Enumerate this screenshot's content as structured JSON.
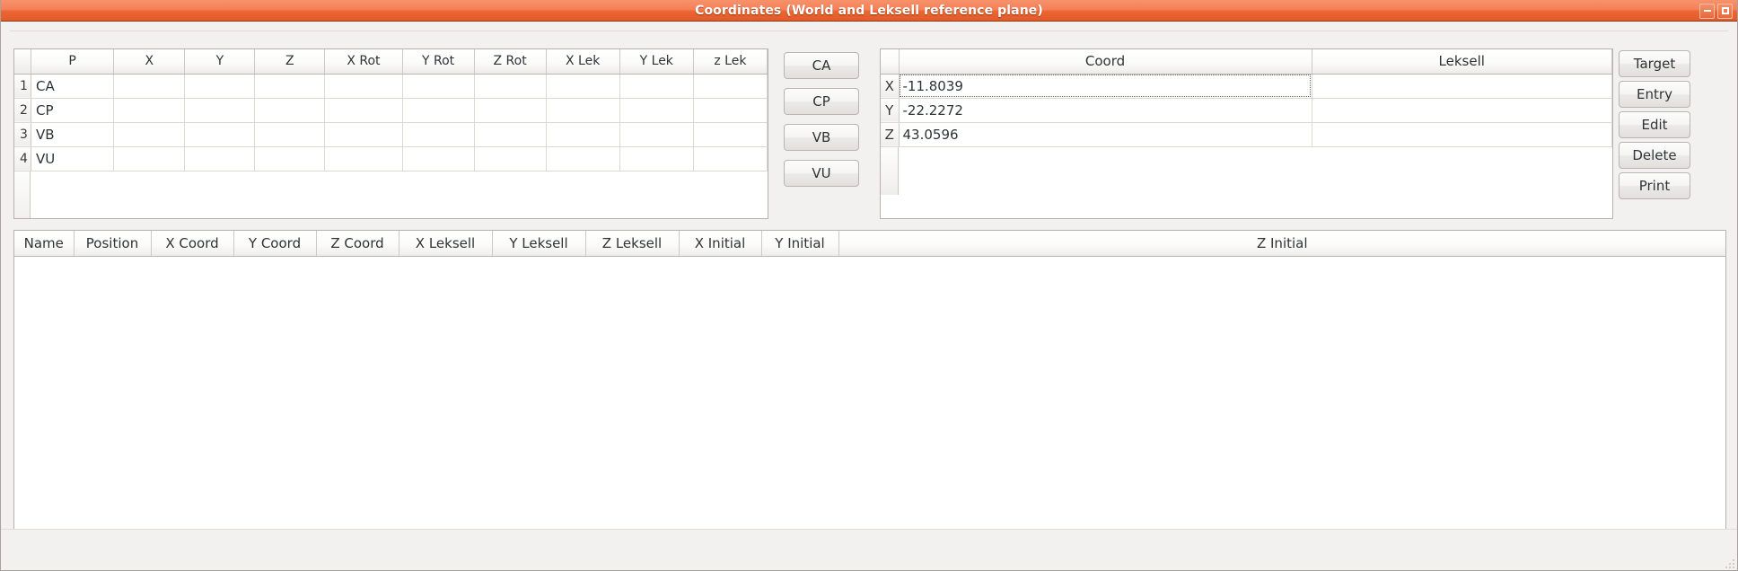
{
  "window": {
    "title": "Coordinates (World and Leksell reference plane)",
    "accent_color": "#e8622f",
    "titlebar_text_color": "#ffffff",
    "controls": {
      "minimize_label": "Minimize",
      "maximize_label": "Maximize"
    }
  },
  "params_table": {
    "headers": [
      "",
      "P",
      "X",
      "Y",
      "Z",
      "X Rot",
      "Y Rot",
      "Z Rot",
      "X Lek",
      "Y Lek",
      "z Lek"
    ],
    "rows": [
      {
        "num": "1",
        "p": "CA",
        "x": "",
        "y": "",
        "z": "",
        "xrot": "",
        "yrot": "",
        "zrot": "",
        "xlek": "",
        "ylek": "",
        "zlek": ""
      },
      {
        "num": "2",
        "p": "CP",
        "x": "",
        "y": "",
        "z": "",
        "xrot": "",
        "yrot": "",
        "zrot": "",
        "xlek": "",
        "ylek": "",
        "zlek": ""
      },
      {
        "num": "3",
        "p": "VB",
        "x": "",
        "y": "",
        "z": "",
        "xrot": "",
        "yrot": "",
        "zrot": "",
        "xlek": "",
        "ylek": "",
        "zlek": ""
      },
      {
        "num": "4",
        "p": "VU",
        "x": "",
        "y": "",
        "z": "",
        "xrot": "",
        "yrot": "",
        "zrot": "",
        "xlek": "",
        "ylek": "",
        "zlek": ""
      }
    ]
  },
  "point_buttons": [
    {
      "label": "CA"
    },
    {
      "label": "CP"
    },
    {
      "label": "VB"
    },
    {
      "label": "VU"
    }
  ],
  "coord_table": {
    "headers": [
      "",
      "Coord",
      "Leksell"
    ],
    "rows": [
      {
        "axis": "X",
        "coord": "-11.8039",
        "leksell": "",
        "selected": true
      },
      {
        "axis": "Y",
        "coord": "-22.2272",
        "leksell": "",
        "selected": false
      },
      {
        "axis": "Z",
        "coord": "43.0596",
        "leksell": "",
        "selected": false
      }
    ]
  },
  "action_buttons": [
    {
      "label": "Target"
    },
    {
      "label": "Entry"
    },
    {
      "label": "Edit"
    },
    {
      "label": "Delete"
    },
    {
      "label": "Print"
    }
  ],
  "list_table": {
    "headers": [
      "Name",
      "Position",
      "X Coord",
      "Y Coord",
      "Z Coord",
      "X Leksell",
      "Y Leksell",
      "Z Leksell",
      "X Initial",
      "Y Initial",
      "Z Initial"
    ],
    "rows": []
  },
  "statusbar": {
    "text": "",
    "grip_icon": "resize-grip-icon"
  }
}
